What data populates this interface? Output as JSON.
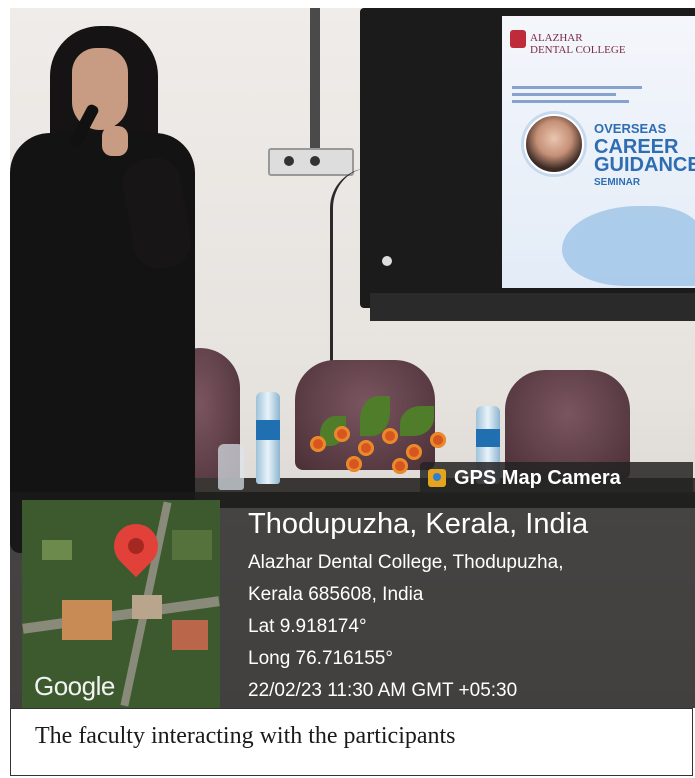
{
  "photo": {
    "screen_slide": {
      "college_name": "ALAZHAR\nDENTAL COLLEGE",
      "seminar_line1": "OVERSEAS",
      "seminar_line2": "CAREER",
      "seminar_line3": "GUIDANCE",
      "seminar_line4": "SEMINAR"
    }
  },
  "overlay": {
    "app_badge": "GPS Map Camera",
    "app_icon": "gps-map-camera-icon",
    "map_brand": "Google",
    "city": "Thodupuzha, Kerala, India",
    "address_line1": "Alazhar Dental College, Thodupuzha,",
    "address_line2": "Kerala 685608, India",
    "latitude": "Lat 9.918174°",
    "longitude": "Long 76.716155°",
    "timestamp": "22/02/23 11:30 AM GMT +05:30",
    "pin_color": "#e2413a"
  },
  "caption": "The faculty interacting with the participants"
}
